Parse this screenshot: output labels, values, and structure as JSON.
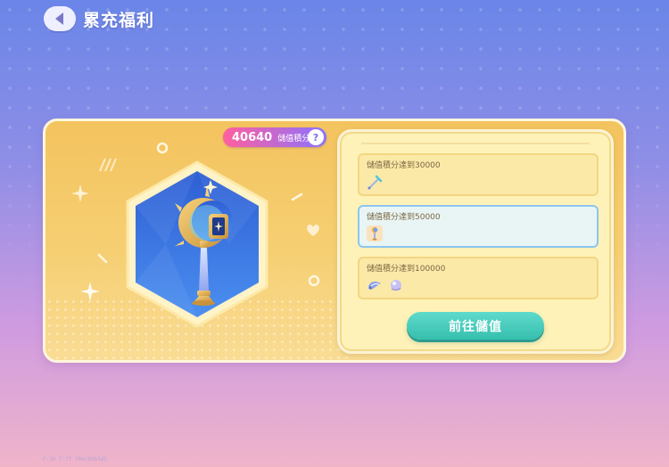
{
  "header": {
    "title": "累充福利"
  },
  "score": {
    "value": "40640",
    "label": "儲值積分",
    "help": "?"
  },
  "tiers": [
    {
      "label": "儲值積分達到30000",
      "items": [
        "wand-icon"
      ]
    },
    {
      "label": "儲值積分達到50000",
      "items": [
        "scepter-icon"
      ],
      "selected": true
    },
    {
      "label": "儲值積分達到100000",
      "items": [
        "wing-icon",
        "orb-icon"
      ]
    }
  ],
  "cta": {
    "label": "前往儲值"
  },
  "footer": {
    "text": "F:30  T:ff  f0ec03b5d5"
  },
  "colors": {
    "accent_pink": "#ff5f9e",
    "accent_purple": "#8a72ff",
    "cta_teal": "#3cc5b4",
    "card_gold": "#f3c35e",
    "hex_blue": "#2f6bd8"
  }
}
